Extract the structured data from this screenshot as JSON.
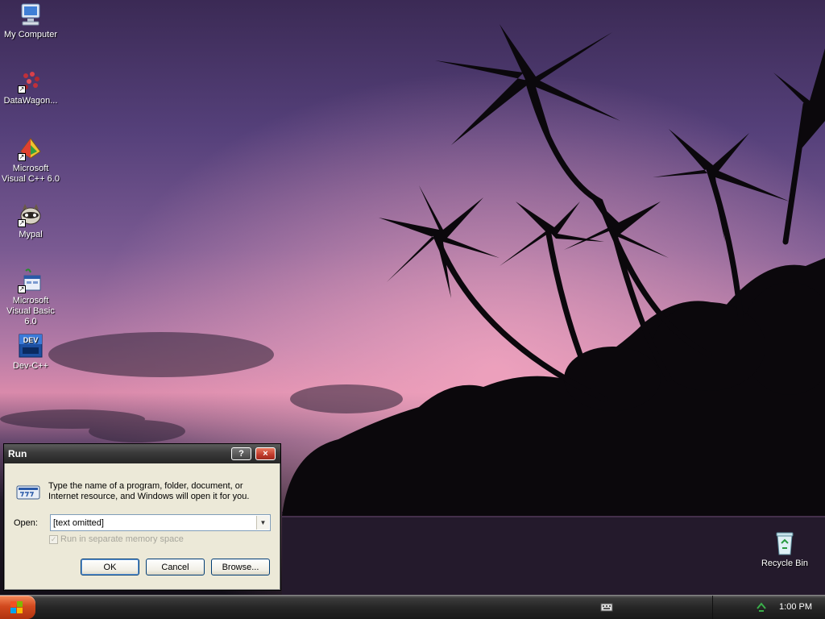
{
  "desktop": {
    "icons": [
      {
        "label": "My Computer"
      },
      {
        "label": "DataWagon..."
      },
      {
        "label": "Microsoft Visual C++ 6.0"
      },
      {
        "label": "Mypal"
      },
      {
        "label": "Microsoft Visual Basic 6.0"
      },
      {
        "label": "Dev-C++"
      }
    ],
    "recycle_bin": {
      "label": "Recycle Bin"
    }
  },
  "run_dialog": {
    "title": "Run",
    "help_glyph": "?",
    "close_glyph": "×",
    "description": "Type the name of a program, folder, document, or Internet resource, and Windows will open it for you.",
    "open_label": "Open:",
    "open_value": "[text omitted]",
    "memory_label": "Run in separate memory space",
    "memory_checked": true,
    "ok_label": "OK",
    "cancel_label": "Cancel",
    "browse_label": "Browse..."
  },
  "taskbar": {
    "clock": "1:00 PM"
  },
  "colors": {
    "sky_top": "#3b2a55",
    "sky_glow": "#d98aab",
    "title_bar": "#3a3a3a",
    "start_button": "#d24a1f"
  }
}
